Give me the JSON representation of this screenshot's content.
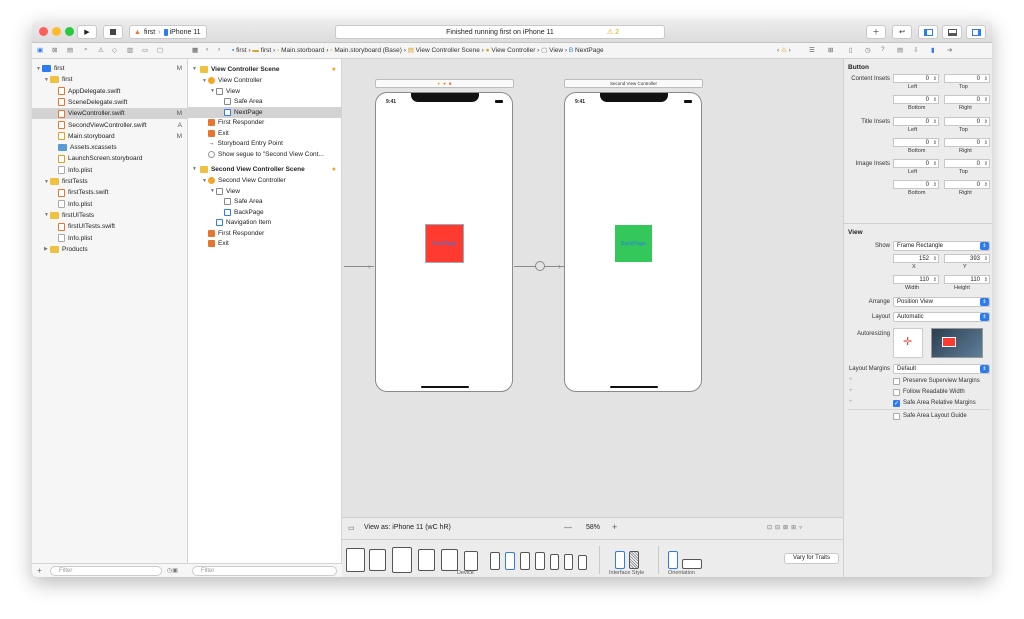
{
  "toolbar": {
    "scheme": "first",
    "device": "iPhone 11",
    "status": "Finished running first on iPhone 11",
    "warnings": "2",
    "colors": {
      "close": "#fe5f57",
      "min": "#febb2e",
      "max": "#28c840",
      "accent": "#2d7bf0"
    }
  },
  "jumpbar": [
    "first",
    "first",
    "Main.storboard",
    "Main.storyboard (Base)",
    "View Controller Scene",
    "View Controller",
    "View",
    "NextPage"
  ],
  "navigator": {
    "rows": [
      {
        "label": "first",
        "badge": "M",
        "level": 0,
        "kind": "project"
      },
      {
        "label": "first",
        "badge": "",
        "level": 1,
        "kind": "folder"
      },
      {
        "label": "AppDelegate.swift",
        "badge": "",
        "level": 2,
        "kind": "swift"
      },
      {
        "label": "SceneDelegate.swift",
        "badge": "",
        "level": 2,
        "kind": "swift"
      },
      {
        "label": "ViewController.swift",
        "badge": "M",
        "level": 2,
        "kind": "swift",
        "selected": true
      },
      {
        "label": "SecondViewController.swift",
        "badge": "A",
        "level": 2,
        "kind": "swift"
      },
      {
        "label": "Main.storyboard",
        "badge": "M",
        "level": 2,
        "kind": "sb"
      },
      {
        "label": "Assets.xcassets",
        "badge": "",
        "level": 2,
        "kind": "assets"
      },
      {
        "label": "LaunchScreen.storyboard",
        "badge": "",
        "level": 2,
        "kind": "sb"
      },
      {
        "label": "Info.plist",
        "badge": "",
        "level": 2,
        "kind": "plist"
      },
      {
        "label": "firstTests",
        "badge": "",
        "level": 1,
        "kind": "folder"
      },
      {
        "label": "firstTests.swift",
        "badge": "",
        "level": 2,
        "kind": "swift"
      },
      {
        "label": "Info.plist",
        "badge": "",
        "level": 2,
        "kind": "plist"
      },
      {
        "label": "firstUITests",
        "badge": "",
        "level": 1,
        "kind": "folder"
      },
      {
        "label": "firstUITests.swift",
        "badge": "",
        "level": 2,
        "kind": "swift"
      },
      {
        "label": "Info.plist",
        "badge": "",
        "level": 2,
        "kind": "plist"
      },
      {
        "label": "Products",
        "badge": "",
        "level": 1,
        "kind": "folder",
        "collapsed": true
      }
    ],
    "filter_placeholder": "Filter"
  },
  "outline": {
    "scene1": {
      "title": "View Controller Scene",
      "items": [
        {
          "label": "View Controller",
          "level": 1,
          "icon": "vc"
        },
        {
          "label": "View",
          "level": 2,
          "icon": "view"
        },
        {
          "label": "Safe Area",
          "level": 3,
          "icon": "view"
        },
        {
          "label": "NextPage",
          "level": 3,
          "icon": "button",
          "selected": true
        },
        {
          "label": "First Responder",
          "level": 1,
          "icon": "responder"
        },
        {
          "label": "Exit",
          "level": 1,
          "icon": "exit"
        },
        {
          "label": "Storyboard Entry Point",
          "level": 1,
          "icon": "arrow"
        },
        {
          "label": "Show segue to \"Second View Cont...",
          "level": 1,
          "icon": "segue"
        }
      ]
    },
    "scene2": {
      "title": "Second View Controller Scene",
      "items": [
        {
          "label": "Second View Controller",
          "level": 1,
          "icon": "vc"
        },
        {
          "label": "View",
          "level": 2,
          "icon": "view"
        },
        {
          "label": "Safe Area",
          "level": 3,
          "icon": "view"
        },
        {
          "label": "BackPage",
          "level": 3,
          "icon": "button"
        },
        {
          "label": "Navigation Item",
          "level": 2,
          "icon": "nav"
        },
        {
          "label": "First Responder",
          "level": 1,
          "icon": "responder"
        },
        {
          "label": "Exit",
          "level": 1,
          "icon": "exit"
        }
      ]
    },
    "filter_placeholder": "Filter"
  },
  "canvas": {
    "scene2_title": "Second View Controller",
    "time": "9:41",
    "next_button": "NextPage",
    "back_button": "BackPage",
    "next_color": "#ff3b30",
    "back_color": "#34c759"
  },
  "bottombar": {
    "view_as": "View as: iPhone 11 (wC hR)",
    "zoom": "58%",
    "device_label": "Device",
    "style_label": "Interface Style",
    "orientation_label": "Orientation",
    "vary": "Vary for Traits"
  },
  "inspector": {
    "section_button": "Button",
    "content_insets": "Content Insets",
    "title_insets": "Title Insets",
    "image_insets": "Image Insets",
    "zero": "0",
    "left": "Left",
    "top": "Top",
    "bottom": "Bottom",
    "right": "Right",
    "section_view": "View",
    "show_label": "Show",
    "show_value": "Frame Rectangle",
    "x": "152",
    "y": "393",
    "x_label": "X",
    "y_label": "Y",
    "width": "110",
    "height": "110",
    "width_label": "Width",
    "height_label": "Height",
    "arrange_label": "Arrange",
    "arrange_value": "Position View",
    "layout_label": "Layout",
    "layout_value": "Automatic",
    "autoresizing_label": "Autoresizing",
    "margins_label": "Layout Margins",
    "margins_value": "Default",
    "preserve": "Preserve Superview Margins",
    "follow": "Follow Readable Width",
    "safe_rel": "Safe Area Relative Margins",
    "safe_guide": "Safe Area Layout Guide"
  }
}
